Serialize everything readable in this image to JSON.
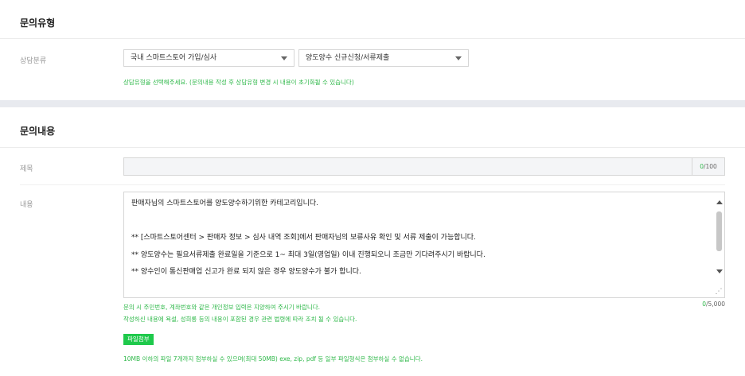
{
  "section1": {
    "title": "문의유형"
  },
  "category": {
    "label": "상담분류",
    "select1": "국내 스마트스토어 가입/심사",
    "select2": "양도양수 신규신청/서류제출",
    "help": "상담유형을 선택해주세요. (문의내용 작성 후 상담유형 변경 시 내용이 초기화될 수 있습니다)"
  },
  "section2": {
    "title": "문의내용"
  },
  "subject": {
    "label": "제목",
    "value": "",
    "count": "0",
    "max": "/100"
  },
  "content": {
    "label": "내용",
    "lines": [
      "판매자님의 스마트스토어를 양도양수하기위한 카테고리입니다.",
      "",
      "** [스마트스토어센터 > 판매자 정보 > 심사 내역 조회]에서 판매자님의 보류사유 확인 및 서류 제출이 가능합니다.",
      "** 양도양수는 필요서류제출 완료일을 기준으로 1~ 최대 3일(영업일) 이내 진행되오니 조금만 기다려주시기 바랍니다.",
      "** 양수인이 통신판매업 신고가 완료 되지 않은 경우 양도양수가 불가 합니다."
    ],
    "count": "0",
    "max": "/5,000",
    "notice_privacy": "문의 시 주민번호, 계좌번호와 같은 개인정보 입력은 지양하여 주시기 바랍니다.",
    "notice_abuse": "작성하신 내용에 욕설, 성희롱 등의 내용이 포함된 경우 관련 법령에 따라 조치 될 수 있습니다."
  },
  "attachment": {
    "button": "파일첨부",
    "help": "10MB 이하의 파일 7개까지 첨부하실 수 있으며(최대 50MB) exe, zip, pdf 등 일부 파일형식은 첨부하실 수 없습니다."
  },
  "colors": {
    "accent": "#1ec94b",
    "help_text": "#2fb84a"
  }
}
